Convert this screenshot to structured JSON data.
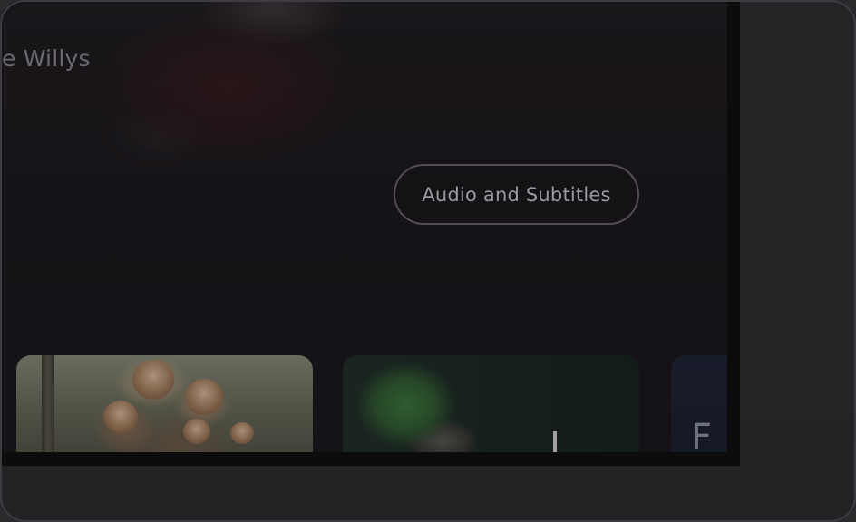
{
  "hero": {
    "credit_text": "ce Willys"
  },
  "actions": {
    "audio_subtitles_label": "Audio and Subtitles"
  },
  "row": {
    "cards": [
      {
        "name": "monkeys-thumbnail"
      },
      {
        "name": "hedgehog-thumbnail"
      },
      {
        "name": "partial-thumbnail",
        "visible_text": "F"
      }
    ]
  },
  "colors": {
    "background": "#141217",
    "button_border": "#68656b",
    "device_frame": "#2a2a2d"
  }
}
